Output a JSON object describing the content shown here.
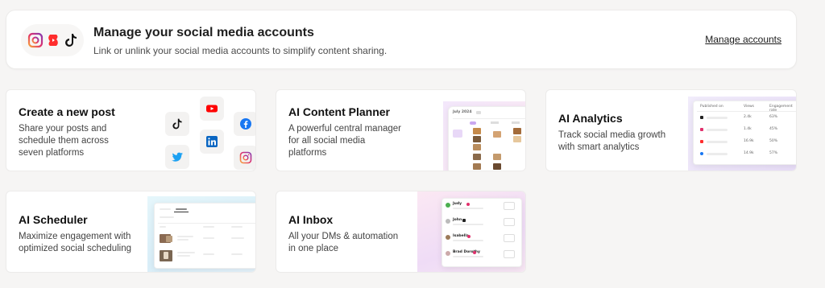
{
  "banner": {
    "title": "Manage your social media accounts",
    "subtitle": "Link or unlink your social media accounts to simplify content sharing.",
    "manage_link": "Manage accounts",
    "icons": [
      "instagram-icon",
      "youtube-shorts-icon",
      "tiktok-icon"
    ]
  },
  "cards": {
    "create_post": {
      "title": "Create a new post",
      "desc_lines": [
        "Share your posts and",
        "schedule them across",
        "seven platforms"
      ],
      "icons": [
        "youtube-icon",
        "tiktok-icon",
        "facebook-icon",
        "linkedin-icon",
        "twitter-icon",
        "instagram-icon"
      ]
    },
    "content_planner": {
      "title": "AI Content Planner",
      "desc_lines": [
        "A powerful central manager",
        "for all social media",
        "platforms"
      ],
      "preview_label": "July 2024"
    },
    "analytics": {
      "title": "AI Analytics",
      "desc_lines": [
        "Track social media growth",
        "with smart analytics"
      ],
      "table_headers": [
        "Published on",
        "Views",
        "Engagement rate"
      ],
      "rows": [
        {
          "views": "2.4k",
          "rate": "63%"
        },
        {
          "views": "1.4k",
          "rate": "45%"
        },
        {
          "views": "16.9k",
          "rate": "50%"
        },
        {
          "views": "14.9k",
          "rate": "57%"
        }
      ]
    },
    "scheduler": {
      "title": "AI Scheduler",
      "desc_lines": [
        "Maximize engagement with",
        "optimized social scheduling"
      ]
    },
    "inbox": {
      "title": "AI Inbox",
      "desc_lines": [
        "All your DMs & automation",
        "in one place"
      ],
      "contacts": [
        "Judy",
        "John",
        "Isabella",
        "Brad Dorothy"
      ]
    }
  },
  "colors": {
    "background": "#f6f5f4",
    "card": "#ffffff",
    "youtube": "#ff0000",
    "facebook": "#1877f2",
    "linkedin": "#0a66c2",
    "twitter": "#1da1f2",
    "instagram": "#e1306c",
    "accent_purple": "#b48ce6"
  }
}
